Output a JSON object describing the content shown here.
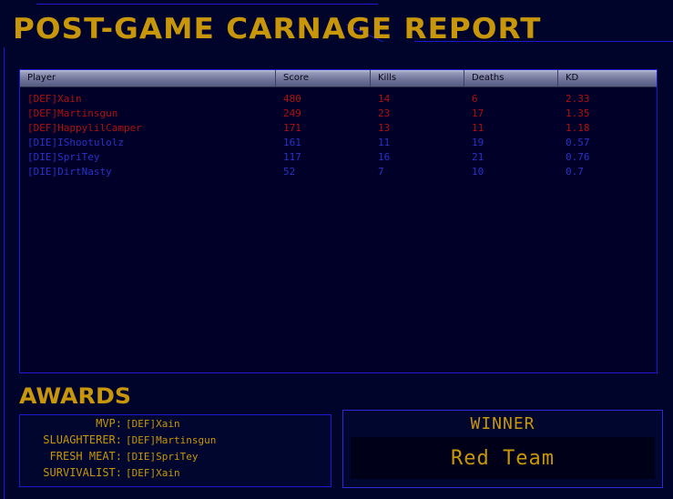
{
  "title": "POST-GAME CARNAGE REPORT",
  "colors": {
    "gold": "#c8960a",
    "red_team": "#b00f0f",
    "blue_team": "#2a31c6",
    "frame_blue": "#1a1ad2",
    "panel_bg": "#000028",
    "page_bg": "#00042a"
  },
  "scoreboard": {
    "columns": [
      {
        "key": "player",
        "label": "Player"
      },
      {
        "key": "score",
        "label": "Score"
      },
      {
        "key": "kills",
        "label": "Kills"
      },
      {
        "key": "deaths",
        "label": "Deaths"
      },
      {
        "key": "kd",
        "label": "KD"
      }
    ],
    "rows": [
      {
        "player": "[DEF]Xain",
        "score": "480",
        "kills": "14",
        "deaths": "6",
        "kd": "2.33",
        "team": "red"
      },
      {
        "player": "[DEF]Martinsgun",
        "score": "249",
        "kills": "23",
        "deaths": "17",
        "kd": "1.35",
        "team": "red"
      },
      {
        "player": "[DEF]HappylilCamper",
        "score": "171",
        "kills": "13",
        "deaths": "11",
        "kd": "1.18",
        "team": "red"
      },
      {
        "player": "[DIE]IShootulolz",
        "score": "161",
        "kills": "11",
        "deaths": "19",
        "kd": "0.57",
        "team": "blue"
      },
      {
        "player": "[DIE]SpriTey",
        "score": "117",
        "kills": "16",
        "deaths": "21",
        "kd": "0.76",
        "team": "blue"
      },
      {
        "player": "[DIE]DirtNasty",
        "score": "52",
        "kills": "7",
        "deaths": "10",
        "kd": "0.7",
        "team": "blue"
      }
    ]
  },
  "awards": {
    "heading": "AWARDS",
    "items": [
      {
        "label": "MVP:",
        "value": "[DEF]Xain"
      },
      {
        "label": "SLUAGHTERER:",
        "value": "[DEF]Martinsgun"
      },
      {
        "label": "FRESH MEAT:",
        "value": "[DIE]SpriTey"
      },
      {
        "label": "SURVIVALIST:",
        "value": "[DEF]Xain"
      }
    ]
  },
  "winner": {
    "label": "WINNER",
    "team": "Red Team"
  }
}
